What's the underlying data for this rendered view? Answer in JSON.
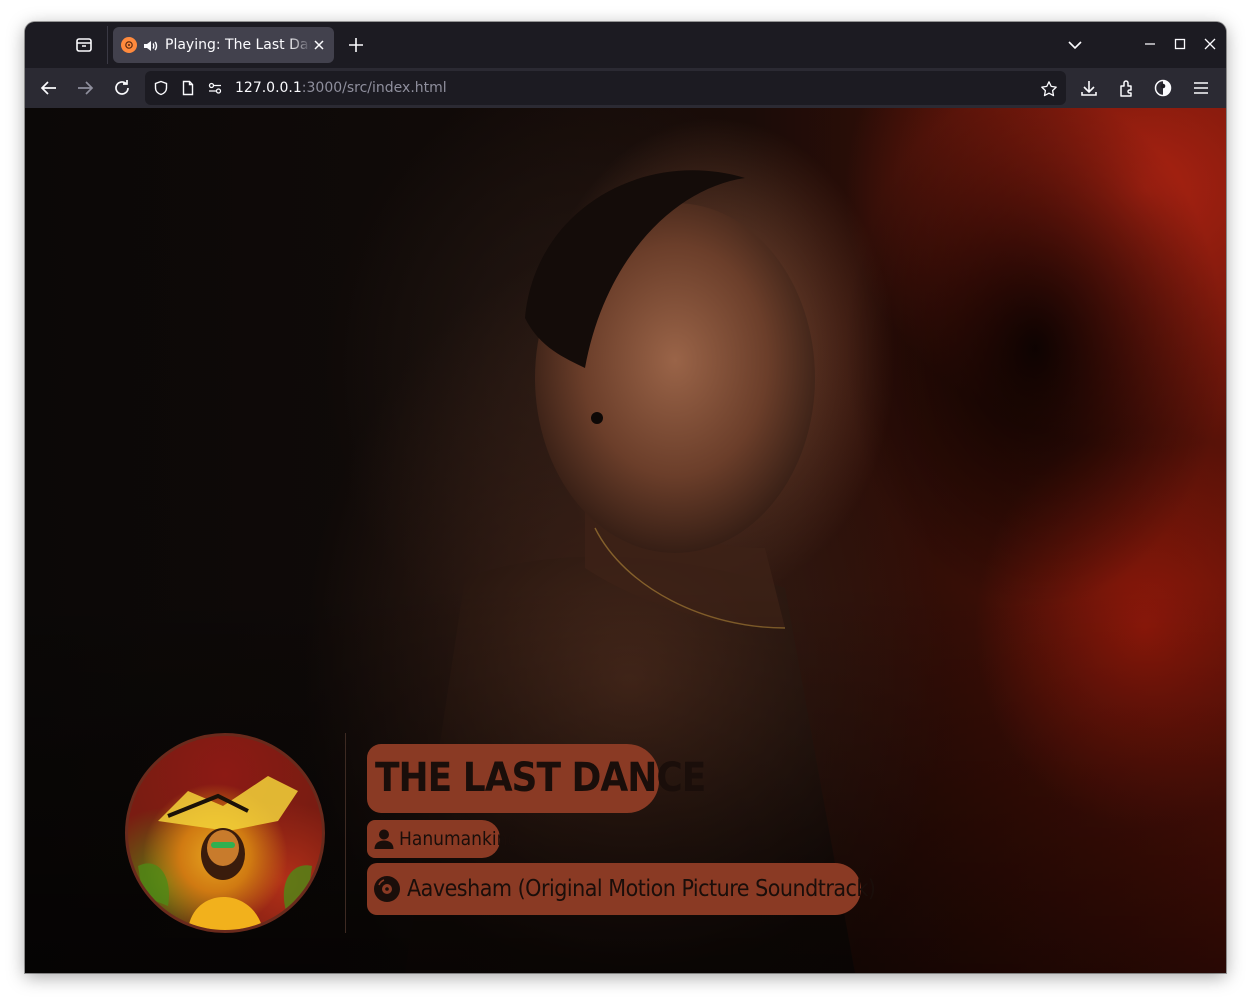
{
  "browser": {
    "tab": {
      "title": "Playing: The Last Dance",
      "favicon": "player-favicon-icon",
      "audio_icon": "speaker-icon"
    },
    "url": {
      "host": "127.0.0.1",
      "rest": ":3000/src/index.html"
    }
  },
  "player": {
    "track_title": "THE LAST DANCE",
    "artist": "Hanumankind",
    "album": "Aavesham (Original Motion Picture Soundtrack)",
    "accent_color": "#8a3a24",
    "text_color": "#1a0e0a"
  }
}
